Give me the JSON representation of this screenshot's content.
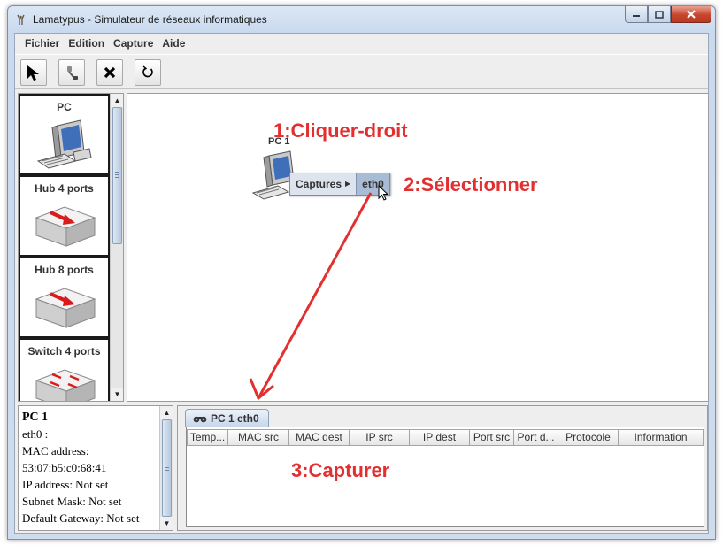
{
  "window": {
    "title": "Lamatypus - Simulateur de réseaux informatiques"
  },
  "menu": [
    "Fichier",
    "Edition",
    "Capture",
    "Aide"
  ],
  "toolbar": {
    "tools": [
      {
        "name": "select-tool",
        "icon": "arrow-pointer-icon"
      },
      {
        "name": "cable-tool",
        "icon": "connector-plug-icon"
      },
      {
        "name": "delete-tool",
        "icon": "x-mark-icon"
      },
      {
        "name": "reset-tool",
        "icon": "refresh-icon"
      }
    ]
  },
  "palette": {
    "items": [
      {
        "label": "PC",
        "icon": "computer-icon"
      },
      {
        "label": "Hub 4 ports",
        "icon": "hub-icon"
      },
      {
        "label": "Hub 8 ports",
        "icon": "hub-icon"
      },
      {
        "label": "Switch 4 ports",
        "icon": "switch-icon"
      }
    ]
  },
  "canvas": {
    "node_label": "PC 1",
    "context_menu": {
      "item": "Captures",
      "submenu_item": "eth0"
    },
    "annotations": {
      "step1": "1:Cliquer-droit",
      "step2": "2:Sélectionner",
      "step3": "3:Capturer"
    },
    "annotation_color": "#e23030"
  },
  "info": {
    "title": "PC 1",
    "lines": [
      "eth0 :",
      "MAC address:",
      "53:07:b5:c0:68:41",
      "IP address: Not set",
      "Subnet Mask: Not set",
      "Default Gateway: Not set"
    ]
  },
  "capture": {
    "tab_label": "PC 1 eth0",
    "columns": [
      "Temp...",
      "MAC src",
      "MAC dest",
      "IP src",
      "IP dest",
      "Port src",
      "Port d...",
      "Protocole",
      "Information"
    ]
  }
}
